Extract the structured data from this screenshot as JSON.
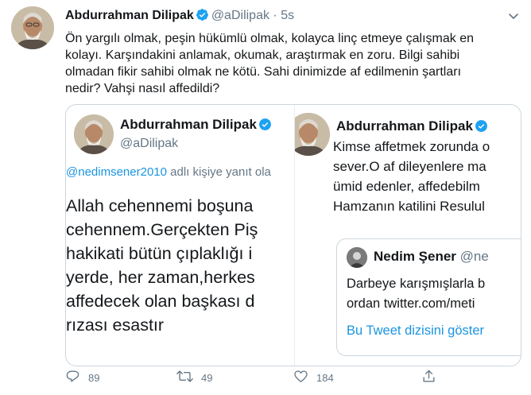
{
  "tweet": {
    "author_name": "Abdurrahman Dilipak",
    "author_handle": "@aDilipak",
    "separator": "·",
    "time": "5s",
    "text_lines": [
      "Ön yargılı olmak, peşin hükümlü olmak, kolayca linç etmeye çalışmak en",
      "kolayı. Karşındakini anlamak, okumak, araştırmak en zoru. Bilgi sahibi",
      "olmadan fikir sahibi olmak ne kötü. Sahi dinimizde af edilmenin şartları",
      "nedir? Vahşi nasıl affedildi?"
    ]
  },
  "quote_left": {
    "author_name": "Abdurrahman Dilipak",
    "author_handle": "@aDilipak",
    "reply_to_handle": "@nedimsener2010",
    "reply_suffix": " adlı kişiye yanıt ola",
    "text_lines": [
      "Allah cehennemi boşuna",
      "cehennem.Gerçekten Piş",
      "hakikati bütün çıplaklığı i",
      "yerde, her zaman,herkes",
      "affedecek olan başkası d",
      "rızası esastır"
    ]
  },
  "quote_right": {
    "author_name": "Abdurrahman Dilipak",
    "text_lines": [
      "Kimse affetmek zorunda o",
      "sever.O af dileyenlere ma",
      "ümid edenler, affedebilm",
      "Hamzanın katilini Resulul"
    ],
    "inner": {
      "author_name": "Nedim Şener",
      "author_handle": "@ne",
      "text_lines": [
        "Darbeye karışmışlarla b",
        "ordan twitter.com/meti"
      ],
      "thread_link": "Bu Tweet dizisini göster"
    }
  },
  "actions": {
    "replies": "89",
    "retweets": "49",
    "likes": "184"
  },
  "colors": {
    "accent": "#1b95e0",
    "muted": "#657786",
    "border": "#ccd6dd"
  }
}
